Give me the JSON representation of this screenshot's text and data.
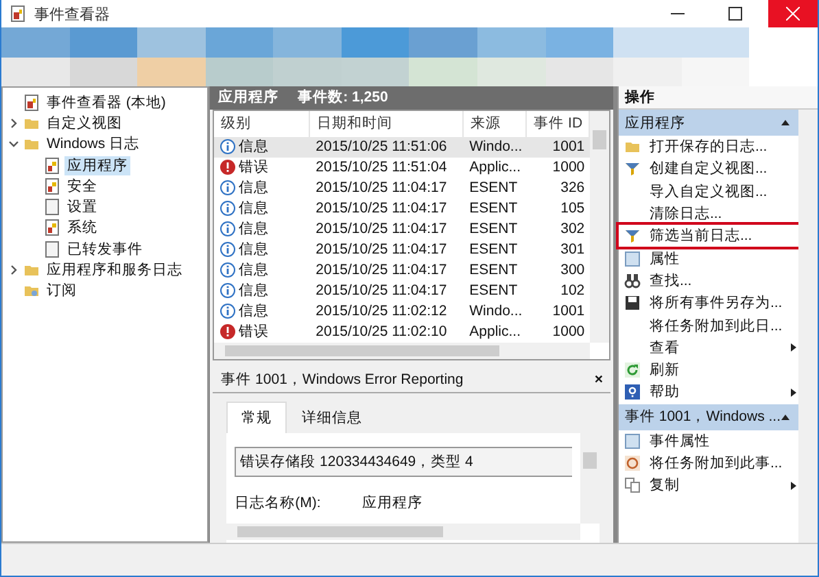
{
  "window": {
    "title": "事件查看器"
  },
  "tree": [
    {
      "label": "事件查看器 (本地)",
      "kind": "root"
    },
    {
      "label": "自定义视图",
      "kind": "folder",
      "expanded": false
    },
    {
      "label": "Windows 日志",
      "kind": "folder",
      "expanded": true,
      "children": [
        {
          "label": "应用程序",
          "kind": "log",
          "selected": true
        },
        {
          "label": "安全",
          "kind": "log",
          "selected": false
        },
        {
          "label": "设置",
          "kind": "page",
          "selected": false
        },
        {
          "label": "系统",
          "kind": "log",
          "selected": false
        },
        {
          "label": "已转发事件",
          "kind": "page",
          "selected": false
        }
      ]
    },
    {
      "label": "应用程序和服务日志",
      "kind": "folder",
      "expanded": false
    },
    {
      "label": "订阅",
      "kind": "sub"
    }
  ],
  "events": {
    "title": "应用程序",
    "count": "事件数: 1,250",
    "columns": [
      "级别",
      "日期和时间",
      "来源",
      "事件 ID"
    ],
    "rows": [
      {
        "kind": "info",
        "level": "信息",
        "date": "2015/10/25 11:51:06",
        "source": "Windo...",
        "id": "1001",
        "selected": true
      },
      {
        "kind": "error",
        "level": "错误",
        "date": "2015/10/25 11:51:04",
        "source": "Applic...",
        "id": "1000",
        "selected": false
      },
      {
        "kind": "info",
        "level": "信息",
        "date": "2015/10/25 11:04:17",
        "source": "ESENT",
        "id": "326",
        "selected": false
      },
      {
        "kind": "info",
        "level": "信息",
        "date": "2015/10/25 11:04:17",
        "source": "ESENT",
        "id": "105",
        "selected": false
      },
      {
        "kind": "info",
        "level": "信息",
        "date": "2015/10/25 11:04:17",
        "source": "ESENT",
        "id": "302",
        "selected": false
      },
      {
        "kind": "info",
        "level": "信息",
        "date": "2015/10/25 11:04:17",
        "source": "ESENT",
        "id": "301",
        "selected": false
      },
      {
        "kind": "info",
        "level": "信息",
        "date": "2015/10/25 11:04:17",
        "source": "ESENT",
        "id": "300",
        "selected": false
      },
      {
        "kind": "info",
        "level": "信息",
        "date": "2015/10/25 11:04:17",
        "source": "ESENT",
        "id": "102",
        "selected": false
      },
      {
        "kind": "info",
        "level": "信息",
        "date": "2015/10/25 11:02:12",
        "source": "Windo...",
        "id": "1001",
        "selected": false
      },
      {
        "kind": "error",
        "level": "错误",
        "date": "2015/10/25 11:02:10",
        "source": "Applic...",
        "id": "1000",
        "selected": false
      }
    ]
  },
  "detail": {
    "title": "事件 1001，Windows Error Reporting",
    "close": "×",
    "tabs": [
      {
        "label": "常规",
        "selected": true
      },
      {
        "label": "详细信息",
        "selected": false
      }
    ],
    "message": "错误存储段 120334434649，类型 4",
    "field_label": "日志名称(M):",
    "field_value": "应用程序"
  },
  "actions": {
    "title": "操作",
    "sections": [
      {
        "title": "应用程序",
        "items": [
          {
            "label": "打开保存的日志...",
            "kind": "folder",
            "submenu": false,
            "highlighted": false
          },
          {
            "label": "创建自定义视图...",
            "kind": "filter",
            "submenu": false,
            "highlighted": false
          },
          {
            "label": "导入自定义视图...",
            "kind": "plain",
            "submenu": false,
            "highlighted": false
          },
          {
            "label": "清除日志...",
            "kind": "plain",
            "submenu": false,
            "highlighted": false
          },
          {
            "label": "筛选当前日志...",
            "kind": "filter",
            "submenu": false,
            "highlighted": true
          },
          {
            "label": "属性",
            "kind": "props",
            "submenu": false,
            "highlighted": false
          },
          {
            "label": "查找...",
            "kind": "find",
            "submenu": false,
            "highlighted": false
          },
          {
            "label": "将所有事件另存为...",
            "kind": "save",
            "submenu": false,
            "highlighted": false
          },
          {
            "label": "将任务附加到此日...",
            "kind": "plain",
            "submenu": false,
            "highlighted": false
          },
          {
            "label": "查看",
            "kind": "plain",
            "submenu": true,
            "highlighted": false
          },
          {
            "label": "刷新",
            "kind": "refresh",
            "submenu": false,
            "highlighted": false
          },
          {
            "label": "帮助",
            "kind": "help",
            "submenu": true,
            "highlighted": false
          }
        ]
      },
      {
        "title": "事件 1001，Windows ...",
        "items": [
          {
            "label": "事件属性",
            "kind": "props",
            "submenu": false,
            "highlighted": false
          },
          {
            "label": "将任务附加到此事...",
            "kind": "task",
            "submenu": false,
            "highlighted": false
          },
          {
            "label": "复制",
            "kind": "copy",
            "submenu": true,
            "highlighted": false
          }
        ]
      }
    ]
  }
}
